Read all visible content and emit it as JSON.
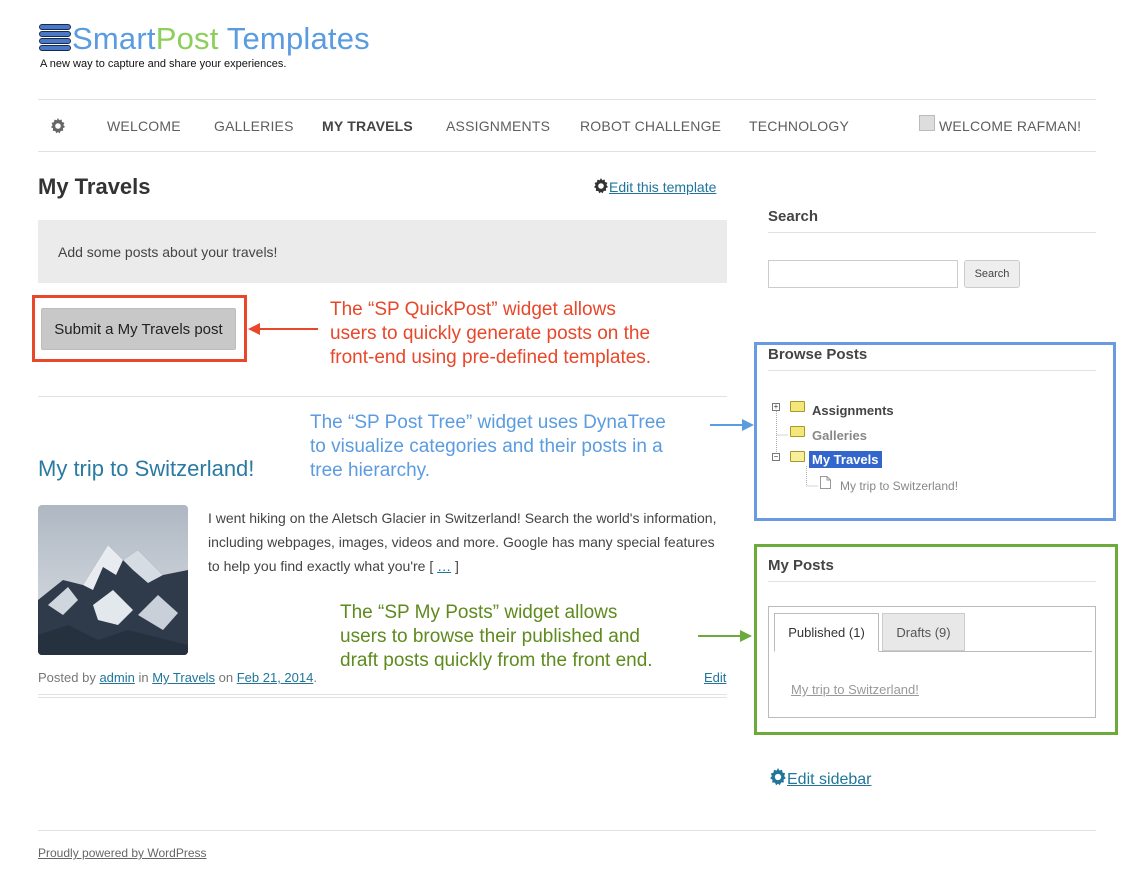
{
  "site": {
    "title_part1": "Smart",
    "title_part2": "Post",
    "title_part3": " Templates",
    "tagline": "A new way to capture and share your experiences."
  },
  "nav": {
    "items": [
      {
        "label": "WELCOME"
      },
      {
        "label": "GALLERIES"
      },
      {
        "label": "MY TRAVELS",
        "active": true
      },
      {
        "label": "ASSIGNMENTS"
      },
      {
        "label": "ROBOT CHALLENGE"
      },
      {
        "label": "TECHNOLOGY"
      }
    ],
    "user_greeting": "WELCOME RAFMAN!",
    "settings_icon": "gear-icon"
  },
  "main": {
    "page_title": "My Travels",
    "edit_template_label": "Edit this template",
    "notice": "Add some posts about your travels!",
    "submit_button": "Submit a My Travels post"
  },
  "annotations": {
    "quickpost": [
      "The “SP QuickPost” widget allows",
      "users to quickly generate posts on the",
      "front-end using pre-defined templates."
    ],
    "post_tree": [
      "The “SP Post Tree” widget uses DynaTree",
      "to visualize categories and their posts in a",
      "tree hierarchy."
    ],
    "my_posts": [
      "The “SP My Posts” widget allows",
      "users to browse their published and",
      "draft posts quickly from the front end."
    ],
    "colors": {
      "red": "#e8472a",
      "blue": "#5b9be0",
      "green": "#6aab3c"
    }
  },
  "post": {
    "title": "My trip to Switzerland!",
    "excerpt": "I went hiking on the Aletsch Glacier in Switzerland! Search the world's information, including webpages, images, videos and more. Google has many special features to help you find exactly what you're [ ",
    "more_label": "…",
    "excerpt_end": " ]",
    "meta_prefix": "Posted by ",
    "author": "admin",
    "meta_in": " in ",
    "category": "My Travels",
    "meta_on": " on ",
    "date": "Feb 21, 2014",
    "meta_end": ".",
    "edit_label": "Edit"
  },
  "sidebar": {
    "search_title": "Search",
    "search_placeholder": "",
    "search_button": "Search",
    "browse_title": "Browse Posts",
    "tree": {
      "assignments": "Assignments",
      "galleries": "Galleries",
      "my_travels": "My Travels",
      "leaf": "My trip to Switzerland!"
    },
    "my_posts_title": "My Posts",
    "tabs": {
      "published": "Published (1)",
      "drafts": "Drafts (9)"
    },
    "published_item": "My trip to Switzerland!",
    "edit_sidebar_label": "Edit sidebar"
  },
  "footer": {
    "powered_by": "Proudly powered by WordPress"
  }
}
